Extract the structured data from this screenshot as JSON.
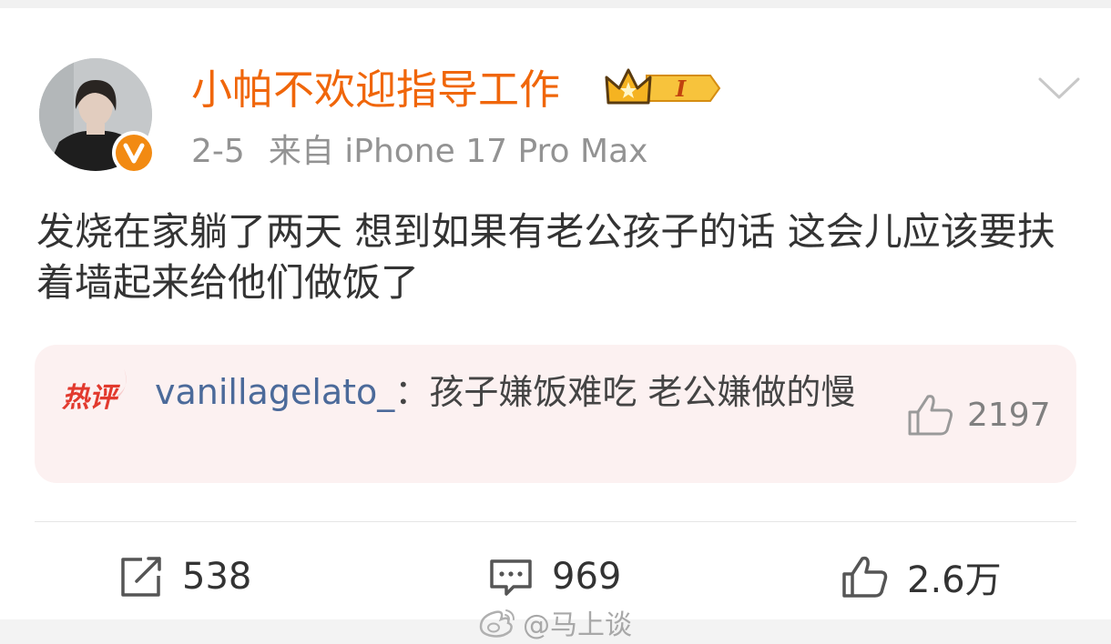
{
  "post": {
    "username": "小帕不欢迎指导工作",
    "badge_level": "I",
    "date": "2-5",
    "source": "来自 iPhone 17 Pro Max",
    "text": "发烧在家躺了两天 想到如果有老公孩子的话 这会儿应该要扶着墙起来给他们做饭了"
  },
  "hot_comment": {
    "tag": "热评",
    "user": "vanillagelato_",
    "separator": "：",
    "text": "孩子嫌饭难吃 老公嫌做的慢",
    "likes": "2197"
  },
  "actions": {
    "repost_count": "538",
    "comment_count": "969",
    "like_count": "2.6万"
  },
  "watermark": "@马上谈",
  "icons": [
    "verified-v-icon",
    "crown-badge-icon",
    "chevron-down-icon",
    "hot-comment-tag-icon",
    "thumbs-up-icon",
    "repost-icon",
    "comment-icon",
    "weibo-logo-icon"
  ],
  "colors": {
    "username": "#f0660a",
    "link": "#4b6a9a",
    "verified": "#f28a12",
    "hot_bg": "#fcf1f1"
  }
}
